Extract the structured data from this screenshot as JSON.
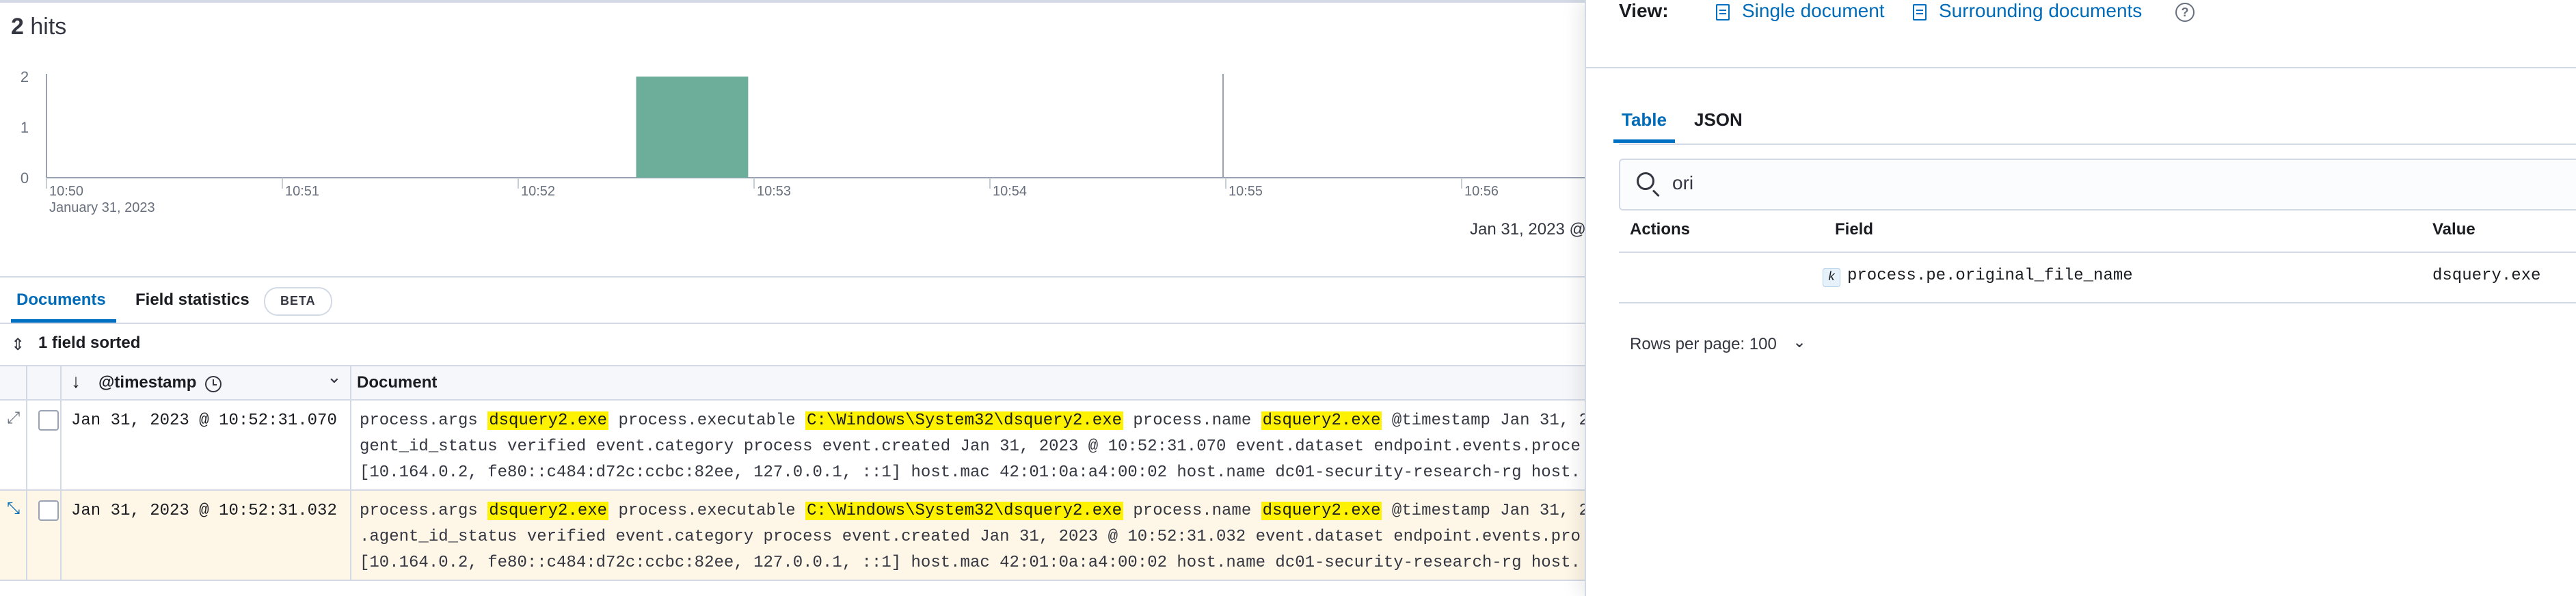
{
  "hits": {
    "count": "2",
    "label": "hits"
  },
  "chart": {
    "y_ticks": [
      "2",
      "1",
      "0"
    ],
    "x_ticks": [
      "10:50",
      "10:51",
      "10:52",
      "10:53",
      "10:54",
      "10:55",
      "10:56"
    ],
    "x_sublabel": "January 31, 2023",
    "end_label": "Jan 31, 2023 @"
  },
  "chart_data": {
    "type": "bar",
    "categories": [
      "10:52:30"
    ],
    "values": [
      2
    ],
    "ylim": [
      0,
      2
    ],
    "xlim": [
      "10:50",
      "10:56+"
    ],
    "grid": false,
    "bar_color": "#6dae9a"
  },
  "tabs": {
    "documents": "Documents",
    "field_statistics": "Field statistics",
    "beta": "BETA"
  },
  "sort": {
    "label": "1 field sorted"
  },
  "grid": {
    "columns": {
      "timestamp": "@timestamp",
      "document": "Document"
    },
    "rows": [
      {
        "timestamp": "Jan 31, 2023 @ 10:52:31.070",
        "line1": [
          {
            "k": "process.args"
          },
          {
            "v": "dsquery2.exe"
          },
          {
            "k": "process.executable"
          },
          {
            "v": "C:\\Windows\\System32\\dsquery2.exe"
          },
          {
            "k": "process.name"
          },
          {
            "v": "dsquery2.exe"
          },
          {
            "k": "@timestamp Jan 31, 2"
          }
        ],
        "line2": "gent_id_status verified event.category process event.created Jan 31, 2023 @ 10:52:31.070 event.dataset endpoint.events.proce",
        "line3": "[10.164.0.2, fe80::c484:d72c:ccbc:82ee, 127.0.0.1, ::1] host.mac 42:01:0a:a4:00:02 host.name dc01-security-research-rg host."
      },
      {
        "timestamp": "Jan 31, 2023 @ 10:52:31.032",
        "line1": [
          {
            "k": "process.args"
          },
          {
            "v": "dsquery2.exe"
          },
          {
            "k": "process.executable"
          },
          {
            "v": "C:\\Windows\\System32\\dsquery2.exe"
          },
          {
            "k": "process.name"
          },
          {
            "v": "dsquery2.exe"
          },
          {
            "k": "@timestamp Jan 31, 2"
          }
        ],
        "line2": ".agent_id_status verified event.category process event.created Jan 31, 2023 @ 10:52:31.032 event.dataset endpoint.events.pro",
        "line3": "[10.164.0.2, fe80::c484:d72c:ccbc:82ee, 127.0.0.1, ::1] host.mac 42:01:0a:a4:00:02 host.name dc01-security-research-rg host."
      }
    ]
  },
  "flyout": {
    "view_label": "View:",
    "single_document": "Single document",
    "surrounding_documents": "Surrounding documents",
    "help": "?",
    "tabs": {
      "table": "Table",
      "json": "JSON"
    },
    "search": {
      "value": "ori"
    },
    "table": {
      "headers": {
        "actions": "Actions",
        "field": "Field",
        "value": "Value"
      },
      "row": {
        "type_badge": "k",
        "field": "process.pe.original_file_name",
        "value": "dsquery.exe"
      }
    },
    "rows_per_page": "Rows per page: 100"
  },
  "icons": {
    "expand": "expand-icon",
    "sort": "sort-arrows-icon",
    "clock": "clock-icon",
    "chevron": "chevron-down-icon",
    "document": "document-icon",
    "search": "search-icon",
    "help": "question-icon"
  }
}
